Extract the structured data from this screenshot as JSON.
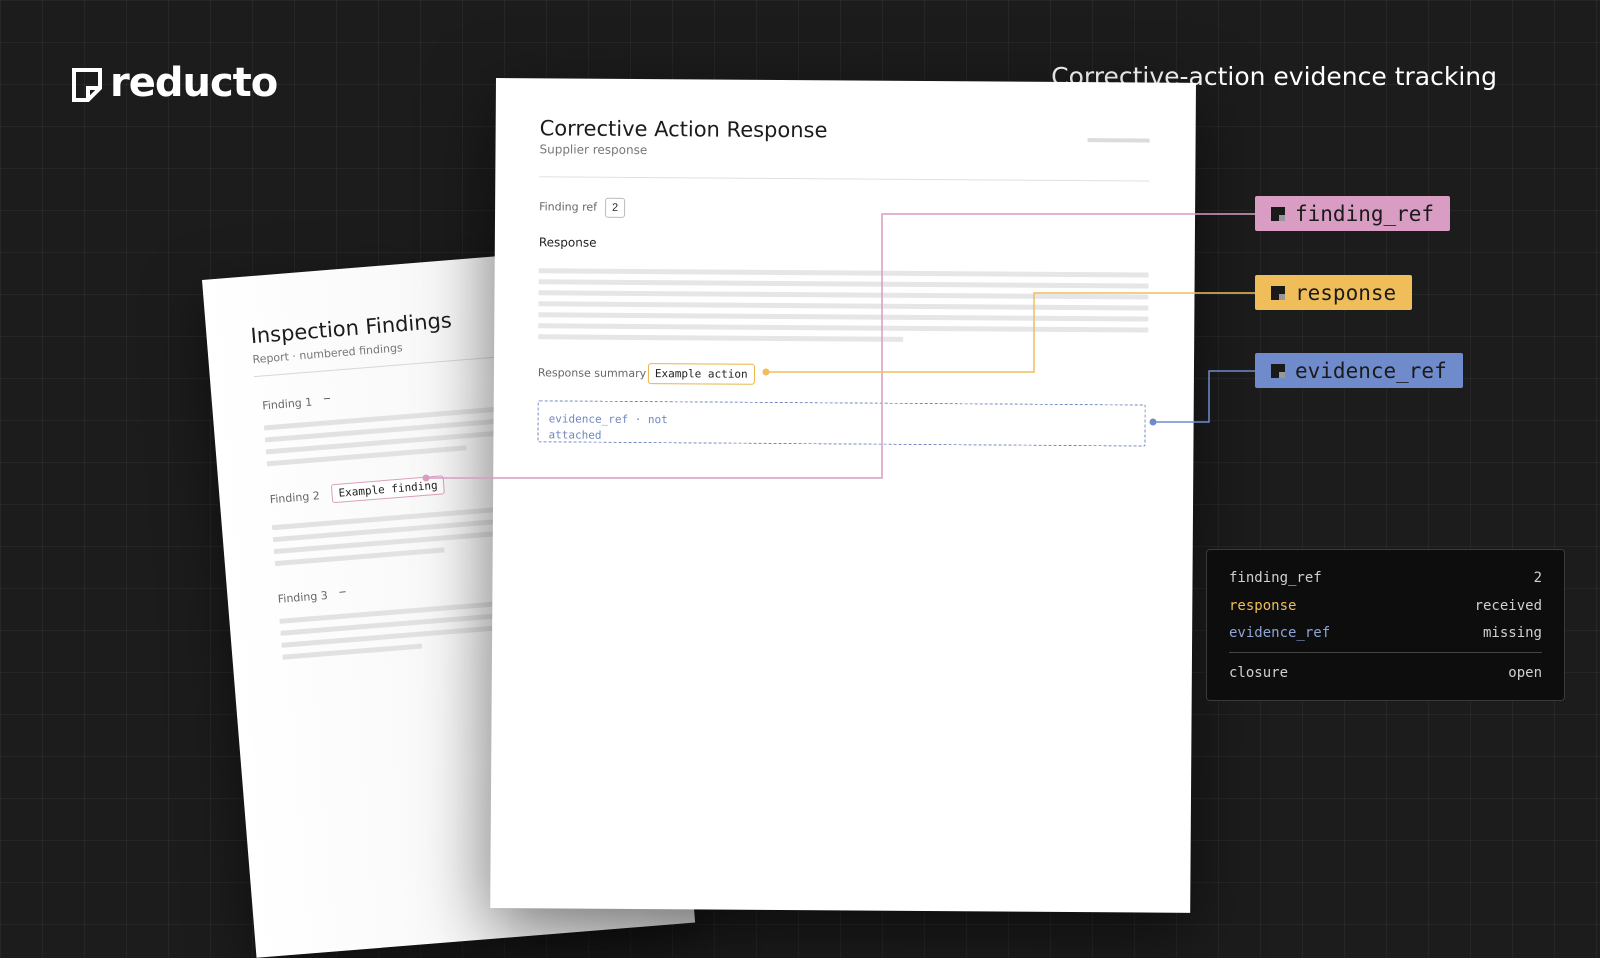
{
  "brand": {
    "name": "reducto"
  },
  "tagline": "Corrective-action evidence tracking",
  "back_doc": {
    "title": "Inspection Findings",
    "subtitle": "Report · numbered findings",
    "findings": [
      {
        "label": "Finding 1",
        "value": "–"
      },
      {
        "label": "Finding 2",
        "tag": "Example finding"
      },
      {
        "label": "Finding 3",
        "value": "–"
      }
    ]
  },
  "front_doc": {
    "title": "Corrective Action Response",
    "subtitle": "Supplier response",
    "finding_ref_label": "Finding ref",
    "finding_ref_value": "2",
    "response_heading": "Response",
    "response_summary_label": "Response summary",
    "response_summary_value": "Example action",
    "evidence_placeholder": "evidence_ref · not attached"
  },
  "fields": [
    {
      "name": "finding_ref",
      "color": "#d99cc2"
    },
    {
      "name": "response",
      "color": "#efbe5b"
    },
    {
      "name": "evidence_ref",
      "color": "#6f8bcc"
    }
  ],
  "summary": {
    "rows": [
      {
        "key": "finding_ref",
        "value": "2",
        "color": "#d0d0d0"
      },
      {
        "key": "response",
        "value": "received",
        "color": "#efbe5b"
      },
      {
        "key": "evidence_ref",
        "value": "missing",
        "color": "#8ea3d6"
      }
    ],
    "closure": {
      "key": "closure",
      "value": "open"
    }
  }
}
